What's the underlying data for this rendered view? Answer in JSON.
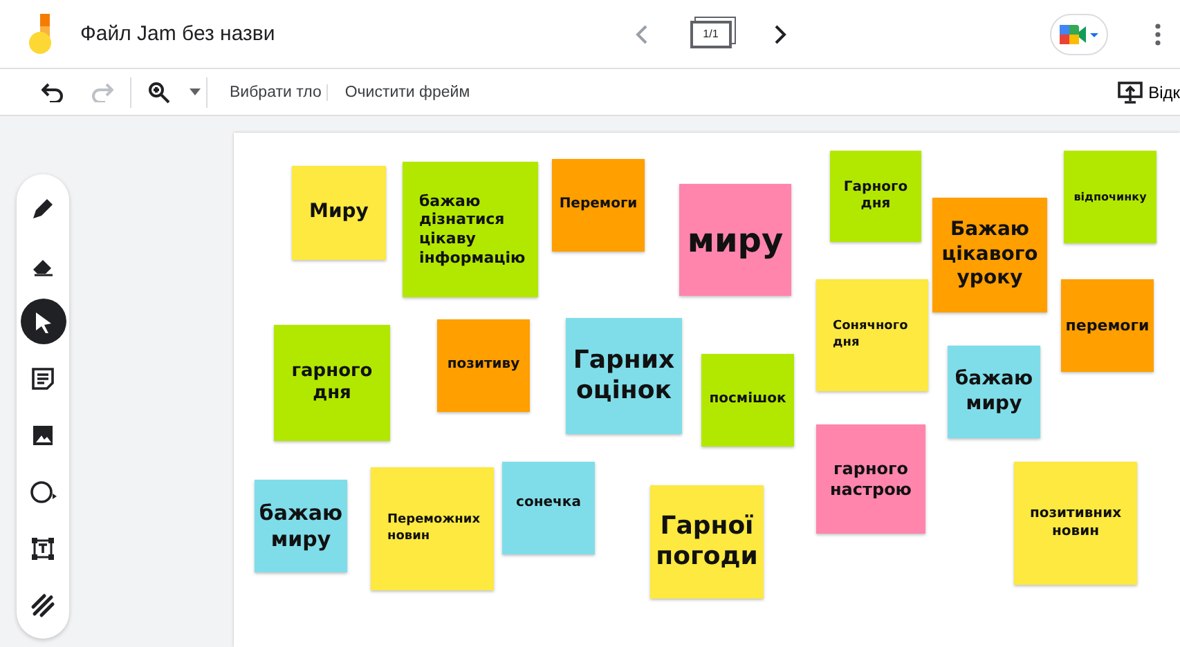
{
  "header": {
    "title": "Файл Jam без назви",
    "frame_counter": "1/1"
  },
  "toolbar": {
    "buttons": [
      "Вибрати тло",
      "Очистити фрейм"
    ],
    "present_button": "Відк"
  },
  "tools": [
    {
      "kind": "pen",
      "selected": false
    },
    {
      "kind": "eraser",
      "selected": false
    },
    {
      "kind": "select",
      "selected": true
    },
    {
      "kind": "note",
      "selected": false
    },
    {
      "kind": "image",
      "selected": false
    },
    {
      "kind": "shape",
      "selected": false
    },
    {
      "kind": "textbox",
      "selected": false
    },
    {
      "kind": "laser",
      "selected": false
    }
  ],
  "notes": [
    {
      "text": "Миру",
      "color": "#fde93f"
    },
    {
      "text": "бажаю дізнатися цікаву інформацію",
      "color": "#b2e800"
    },
    {
      "text": "Перемоги",
      "color": "#ff9f00"
    },
    {
      "text": "миру",
      "color": "#ff85ad"
    },
    {
      "text": "Гарного дня",
      "color": "#b2e800"
    },
    {
      "text": "Бажаю цікавого уроку",
      "color": "#ff9f00"
    },
    {
      "text": "відпочинку",
      "color": "#b2e800"
    },
    {
      "text": "гарного дня",
      "color": "#b2e800"
    },
    {
      "text": "позитиву",
      "color": "#ff9f00"
    },
    {
      "text": "Гарних оцінок",
      "color": "#7fdde9"
    },
    {
      "text": "посмішок",
      "color": "#b2e800"
    },
    {
      "text": "Сонячного дня",
      "color": "#fde93f"
    },
    {
      "text": "перемоги",
      "color": "#ff9f00"
    },
    {
      "text": "бажаю миру",
      "color": "#7fdde9"
    },
    {
      "text": "бажаю миру",
      "color": "#7fdde9"
    },
    {
      "text": "Переможних новин",
      "color": "#fde93f"
    },
    {
      "text": "сонечка",
      "color": "#7fdde9"
    },
    {
      "text": "Гарної погоди",
      "color": "#fde93f"
    },
    {
      "text": "гарного настрою",
      "color": "#ff85ad"
    },
    {
      "text": "позитивних новин",
      "color": "#fde93f"
    }
  ]
}
